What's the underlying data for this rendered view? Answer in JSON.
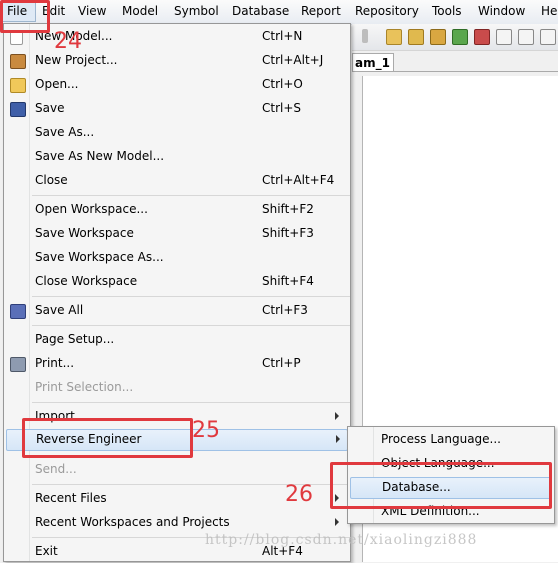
{
  "menubar": {
    "items": [
      "File",
      "Edit",
      "View",
      "Model",
      "Symbol",
      "Database",
      "Report",
      "Repository",
      "Tools",
      "Window",
      "He"
    ]
  },
  "tab": {
    "label": "am_1"
  },
  "file_menu": {
    "items": [
      {
        "label": "New Model...",
        "shortcut": "Ctrl+N",
        "icon": "new-model-icon"
      },
      {
        "label": "New Project...",
        "shortcut": "Ctrl+Alt+J",
        "icon": "new-project-icon"
      },
      {
        "label": "Open...",
        "shortcut": "Ctrl+O",
        "icon": "open-folder-icon"
      },
      {
        "label": "Save",
        "shortcut": "Ctrl+S",
        "icon": "save-disk-icon"
      },
      {
        "label": "Save As...",
        "shortcut": ""
      },
      {
        "label": "Save As New Model...",
        "shortcut": ""
      },
      {
        "label": "Close",
        "shortcut": "Ctrl+Alt+F4"
      },
      {
        "label": "Open Workspace...",
        "shortcut": "Shift+F2"
      },
      {
        "label": "Save Workspace",
        "shortcut": "Shift+F3"
      },
      {
        "label": "Save Workspace As...",
        "shortcut": ""
      },
      {
        "label": "Close Workspace",
        "shortcut": "Shift+F4"
      },
      {
        "label": "Save All",
        "shortcut": "Ctrl+F3",
        "icon": "save-all-icon"
      },
      {
        "label": "Page Setup...",
        "shortcut": ""
      },
      {
        "label": "Print...",
        "shortcut": "Ctrl+P",
        "icon": "printer-icon"
      },
      {
        "label": "Print Selection...",
        "shortcut": "",
        "disabled": true
      },
      {
        "label": "Import",
        "shortcut": "",
        "submenu": true
      },
      {
        "label": "Reverse Engineer",
        "shortcut": "",
        "submenu": true,
        "highlighted": true
      },
      {
        "label": "Send...",
        "shortcut": "",
        "disabled": true
      },
      {
        "label": "Recent Files",
        "shortcut": "",
        "submenu": true
      },
      {
        "label": "Recent Workspaces and Projects",
        "shortcut": "",
        "submenu": true
      },
      {
        "label": "Exit",
        "shortcut": "Alt+F4"
      }
    ]
  },
  "reverse_engineer_submenu": {
    "items": [
      "Process Language...",
      "Object Language...",
      "Database...",
      "XML Definition..."
    ],
    "highlighted_index": 2
  },
  "annotations": {
    "step1": "24",
    "step2": "25",
    "step3": "26",
    "color": "#e0393e"
  },
  "watermark": "http://blog.csdn.net/xiaolingzi888"
}
